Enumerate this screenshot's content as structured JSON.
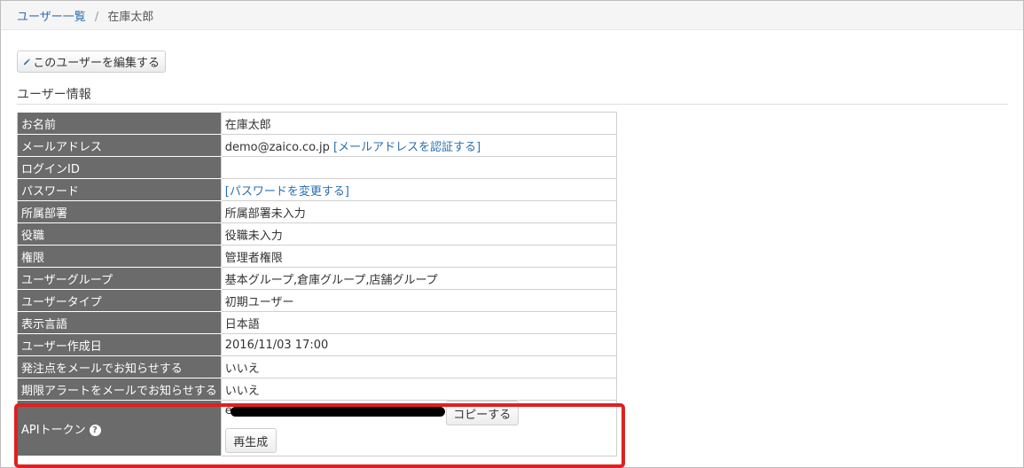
{
  "breadcrumb": {
    "parent_label": "ユーザー一覧",
    "separator": "/",
    "current_label": "在庫太郎"
  },
  "toolbar": {
    "edit_user_label": "このユーザーを編集する"
  },
  "section": {
    "title": "ユーザー情報"
  },
  "user_info": {
    "name": {
      "label": "お名前",
      "value": "在庫太郎"
    },
    "email": {
      "label": "メールアドレス",
      "value": "demo@zaico.co.jp",
      "verify_link": "[メールアドレスを認証する]"
    },
    "login_id": {
      "label": "ログインID",
      "value": ""
    },
    "password": {
      "label": "パスワード",
      "change_link": "[パスワードを変更する]"
    },
    "department": {
      "label": "所属部署",
      "value": "所属部署未入力"
    },
    "position": {
      "label": "役職",
      "value": "役職未入力"
    },
    "permission": {
      "label": "権限",
      "value": "管理者権限"
    },
    "user_group": {
      "label": "ユーザーグループ",
      "value": "基本グループ,倉庫グループ,店舗グループ"
    },
    "user_type": {
      "label": "ユーザータイプ",
      "value": "初期ユーザー"
    },
    "display_language": {
      "label": "表示言語",
      "value": "日本語"
    },
    "created_at": {
      "label": "ユーザー作成日",
      "value": "2016/11/03 17:00"
    },
    "order_point_notify": {
      "label": "発注点をメールでお知らせする",
      "value": "いいえ"
    },
    "expiry_alert_notify": {
      "label": "期限アラートをメールでお知らせする",
      "value": "いいえ"
    },
    "api_token": {
      "label": "APIトークン",
      "value_prefix": "e",
      "copy_label": "コピーする",
      "regenerate_label": "再生成"
    }
  },
  "icons": {
    "edit": "pencil-icon",
    "help": "question-circle-icon"
  },
  "colors": {
    "label_cell_bg": "#6b6b6b",
    "link": "#2a6fb0",
    "highlight": "#e02020"
  }
}
